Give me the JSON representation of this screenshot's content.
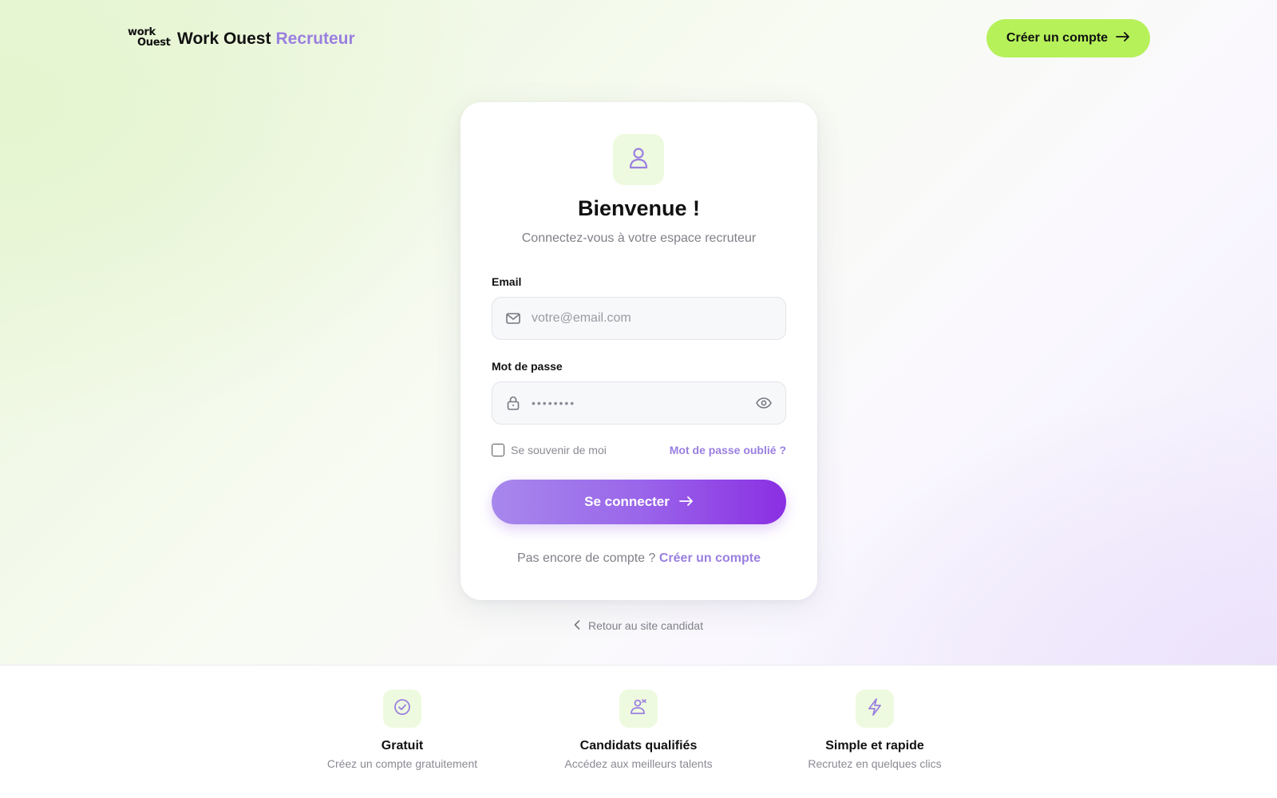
{
  "header": {
    "logo_line1": "work",
    "logo_line2": "Ouest",
    "brand_name": "Work Ouest",
    "brand_accent": "Recruteur",
    "cta_label": "Créer un compte",
    "cta_icon": "arrow-right-icon"
  },
  "card": {
    "icon": "user-icon",
    "title": "Bienvenue !",
    "subtitle": "Connectez-vous à votre espace recruteur",
    "email": {
      "label": "Email",
      "icon": "mail-icon",
      "placeholder": "votre@email.com",
      "value": ""
    },
    "password": {
      "label": "Mot de passe",
      "icon": "lock-icon",
      "masked_value": "••••••••",
      "toggle_icon": "eye-icon"
    },
    "remember_label": "Se souvenir de moi",
    "remember_checked": false,
    "forgot_label": "Mot de passe oublié ?",
    "submit_label": "Se connecter",
    "signup_prompt": "Pas encore de compte ?",
    "signup_link": "Créer un compte"
  },
  "back_link": "Retour au site candidat",
  "features": [
    {
      "icon": "check-circle-icon",
      "title": "Gratuit",
      "desc": "Créez un compte gratuitement"
    },
    {
      "icon": "users-icon",
      "title": "Candidats qualifiés",
      "desc": "Accédez aux meilleurs talents"
    },
    {
      "icon": "lightning-icon",
      "title": "Simple et rapide",
      "desc": "Recrutez en quelques clics"
    }
  ],
  "colors": {
    "accent_purple": "#9a7fe0",
    "accent_green": "#b6f15a",
    "button_gradient_start": "#a788ec",
    "button_gradient_end": "#8a2fe2",
    "icon_bg": "#eefadf"
  }
}
